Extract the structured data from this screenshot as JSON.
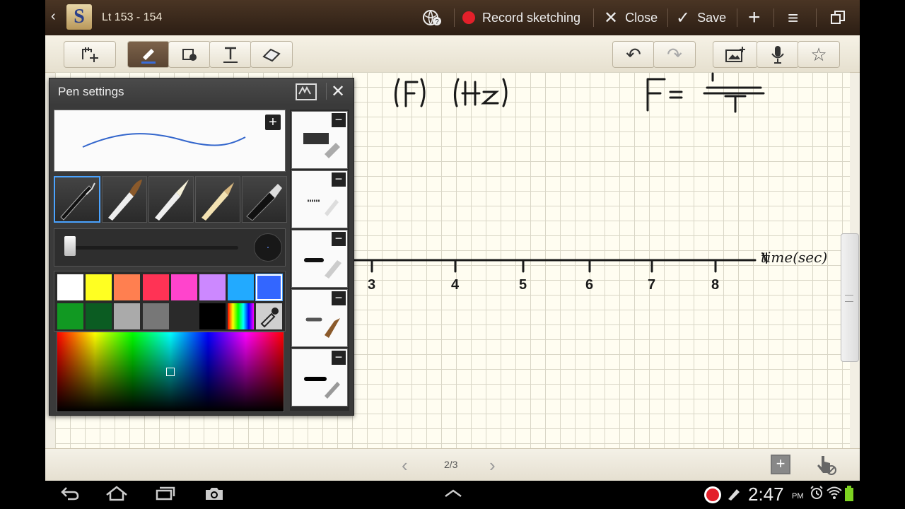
{
  "titlebar": {
    "doc_title": "Lt 153 - 154",
    "logo_letter": "S",
    "record_label": "Record sketching",
    "close_label": "Close",
    "save_label": "Save",
    "icons": [
      "back-icon",
      "help-globe-icon",
      "record-icon",
      "close-icon",
      "save-check-icon",
      "add-icon",
      "menu-icon",
      "window-icon"
    ]
  },
  "toolbar": {
    "tools": [
      "select-tool-icon",
      "pen-tool-icon",
      "fill-tool-icon",
      "text-tool-icon",
      "eraser-tool-icon"
    ],
    "active_tool": "pen-tool-icon",
    "right_icons": [
      "undo-icon",
      "redo-icon",
      "insert-image-icon",
      "microphone-icon",
      "favorite-star-icon"
    ]
  },
  "pen_settings": {
    "title": "Pen settings",
    "brushes": [
      "pen",
      "brush",
      "calligraphy",
      "pencil",
      "marker"
    ],
    "selected_brush": "pen",
    "colors_row1": [
      "#ffffff",
      "#ffff22",
      "#ff7f50",
      "#ff3355",
      "#ff44cc",
      "#cc88ff",
      "#22aaff",
      "#3366ff"
    ],
    "colors_row2": [
      "#119922",
      "#0b5c22",
      "#aaaaaa",
      "#777777",
      "#2a2a2a",
      "#000000",
      "rainbow",
      "eyedropper"
    ],
    "selected_color": "#3366ff",
    "stroke_color": "#3366cc"
  },
  "canvas": {
    "axis_label": "time(sec)",
    "ticks": [
      "3",
      "4",
      "5",
      "6",
      "7",
      "8"
    ],
    "note_top_left": "(F)(Hz)",
    "note_top_right": "F ="
  },
  "bottombar": {
    "page_indicator": "2/3"
  },
  "system": {
    "time": "2:47",
    "ampm": "PM"
  }
}
